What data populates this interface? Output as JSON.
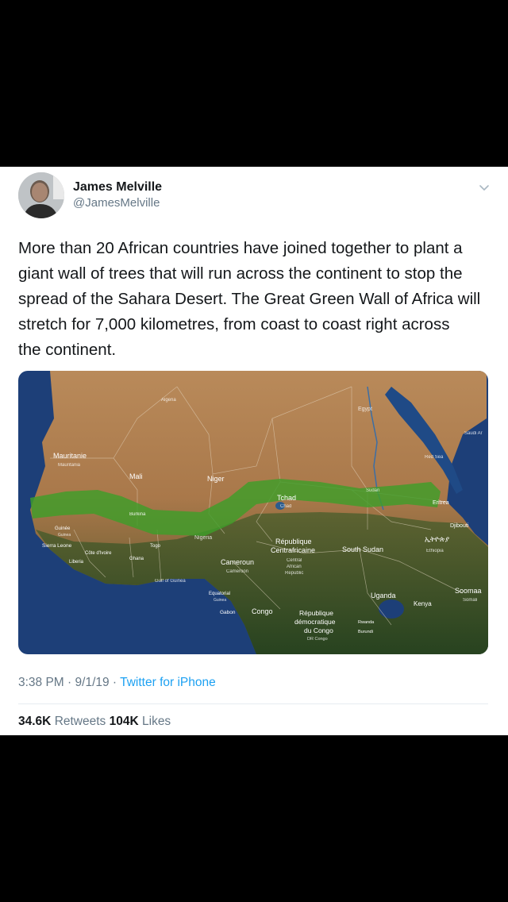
{
  "author": {
    "name": "James Melville",
    "handle": "@JamesMelville"
  },
  "tweet": {
    "lines": [
      "More than 20 African countries have joined together to plant a",
      "giant wall of trees that will run across the continent to stop the",
      "spread of the Sahara Desert. The Great Green Wall of Africa will",
      "stretch for 7,000 kilometres, from coast to coast right across",
      "the continent."
    ]
  },
  "map": {
    "labels": {
      "mauritanie": "Mauritanie",
      "mauritania": "Mauritania",
      "mali": "Mali",
      "niger": "Niger",
      "chad": "Tchad",
      "chad_en": "Chad",
      "algeria": "Algeria",
      "egypt": "Egypt",
      "sudan": "Sudan",
      "eritrea": "Eritrea",
      "djibouti": "Djibouti",
      "ethiopia": "Ethiopia",
      "ethiopia_native": "ኢትዮጵያ",
      "somalia": "Soomaa",
      "somalia_en": "Somali",
      "red_sea": "Red Sea",
      "saudi": "Saudi Ar",
      "guinee": "Guinée",
      "guinea": "Guinea",
      "sierra_leone": "Sierra Leone",
      "cote_divoire": "Côte d'Ivoire",
      "liberia": "Liberia",
      "ghana": "Ghana",
      "togo": "Togo",
      "burkina": "Burkina",
      "nigeria": "Nigeria",
      "cameroun": "Cameroun",
      "cameroon": "Cameroon",
      "car_fr_1": "République",
      "car_fr_2": "Centrafricaine",
      "car_en_1": "Central",
      "car_en_2": "African",
      "car_en_3": "Republic",
      "south_sudan": "South Sudan",
      "gulf_of_guinea": "Gulf of Guinea",
      "eq_guinea": "Equatorial",
      "eq_guinea_en": "Guinea",
      "gabon": "Gabon",
      "congo": "Congo",
      "drc_1": "République",
      "drc_2": "démocratique",
      "drc_3": "du Congo",
      "drc_en": "DR Congo",
      "uganda": "Uganda",
      "kenya": "Kenya",
      "rwanda": "Rwanda",
      "burundi": "Burundi"
    }
  },
  "meta": {
    "time": "3:38 PM",
    "separator": " · ",
    "date": "9/1/19",
    "source": "Twitter for iPhone"
  },
  "stats": {
    "retweets_count": "34.6K",
    "retweets_label": "Retweets",
    "likes_count": "104K",
    "likes_label": "Likes"
  },
  "colors": {
    "text": "#14171a",
    "secondary": "#657786",
    "link": "#1da1f2",
    "wall_green": "#3e9e2a"
  }
}
